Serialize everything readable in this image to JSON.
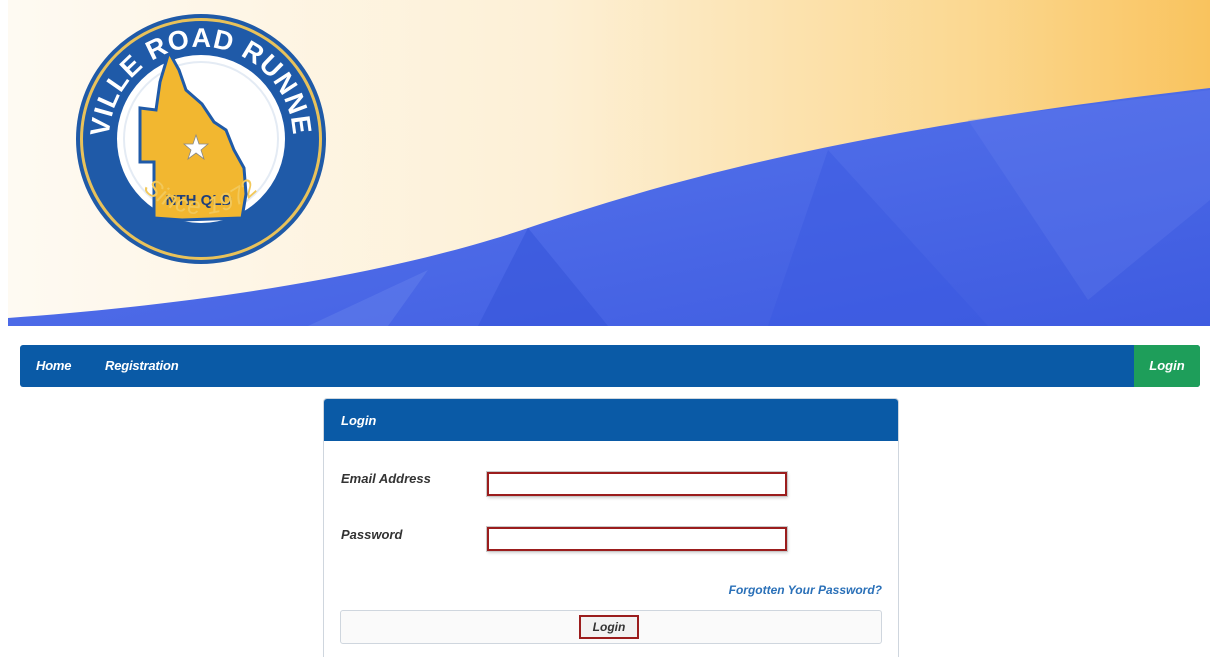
{
  "banner": {
    "logo": {
      "ring_text": "TOWNSVILLE ROAD RUNNERS INC.",
      "bottom_text": "Since 1972",
      "center_text": "NTH QLD"
    },
    "colors": {
      "cream": "#fdf2dc",
      "orange": "#f9c66a",
      "blue": "#4a66e6",
      "logo_blue": "#1f5aa8",
      "logo_gold": "#f2b730"
    }
  },
  "nav": {
    "home": "Home",
    "registration": "Registration",
    "login": "Login",
    "bar_color": "#0a5aa6",
    "login_color": "#1e9e5a"
  },
  "login_panel": {
    "title": "Login",
    "email_label": "Email Address",
    "email_value": "",
    "password_label": "Password",
    "password_value": "",
    "forgot_link": "Forgotten Your Password?",
    "submit_label": "Login",
    "highlight_color": "#9b1d1d"
  }
}
